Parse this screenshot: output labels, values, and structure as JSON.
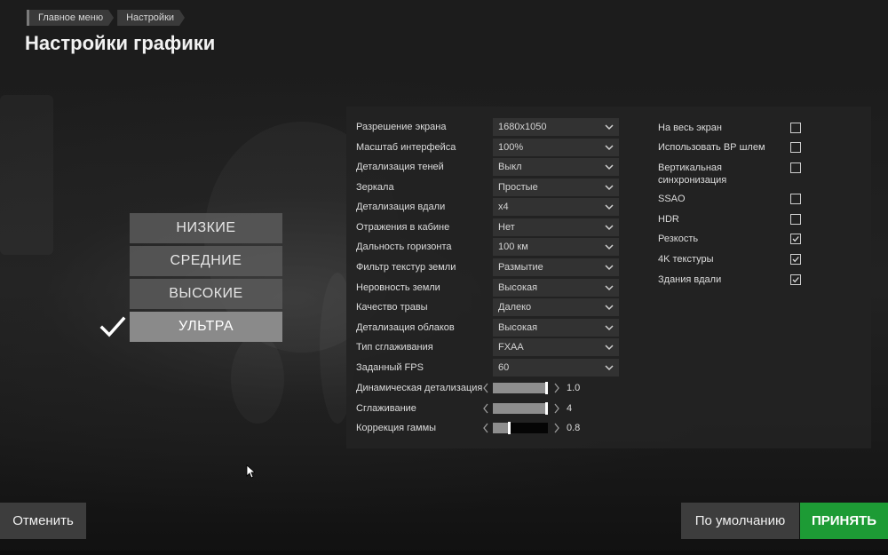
{
  "breadcrumb": [
    "Главное меню",
    "Настройки"
  ],
  "page_title": "Настройки графики",
  "presets": [
    {
      "label": "НИЗКИЕ",
      "active": false
    },
    {
      "label": "СРЕДНИЕ",
      "active": false
    },
    {
      "label": "ВЫСОКИЕ",
      "active": false
    },
    {
      "label": "УЛЬТРА",
      "active": true
    }
  ],
  "dropdowns": [
    {
      "label": "Разрешение экрана",
      "value": "1680x1050"
    },
    {
      "label": "Масштаб интерфейса",
      "value": "100%"
    },
    {
      "label": "Детализация теней",
      "value": "Выкл"
    },
    {
      "label": "Зеркала",
      "value": "Простые"
    },
    {
      "label": "Детализация вдали",
      "value": "x4"
    },
    {
      "label": "Отражения в кабине",
      "value": "Нет"
    },
    {
      "label": "Дальность горизонта",
      "value": "100 км"
    },
    {
      "label": "Фильтр текстур земли",
      "value": "Размытие"
    },
    {
      "label": "Неровность земли",
      "value": "Высокая"
    },
    {
      "label": "Качество травы",
      "value": "Далеко"
    },
    {
      "label": "Детализация облаков",
      "value": "Высокая"
    },
    {
      "label": "Тип сглаживания",
      "value": "FXAA"
    },
    {
      "label": "Заданный FPS",
      "value": "60"
    }
  ],
  "sliders": [
    {
      "label": "Динамическая детализация",
      "value": "1.0",
      "fraction": 1.0
    },
    {
      "label": "Сглаживание",
      "value": "4",
      "fraction": 1.0
    },
    {
      "label": "Коррекция гаммы",
      "value": "0.8",
      "fraction": 0.32
    }
  ],
  "checkboxes": [
    {
      "label": "На весь экран",
      "checked": false
    },
    {
      "label": "Использовать ВР шлем",
      "checked": false
    },
    {
      "label": "Вертикальная синхронизация",
      "checked": false
    },
    {
      "label": "SSAO",
      "checked": false
    },
    {
      "label": "HDR",
      "checked": false
    },
    {
      "label": "Резкость",
      "checked": true
    },
    {
      "label": "4K текстуры",
      "checked": true
    },
    {
      "label": "Здания вдали",
      "checked": true
    }
  ],
  "buttons": {
    "cancel": "Отменить",
    "default": "По умолчанию",
    "accept": "ПРИНЯТЬ"
  },
  "colors": {
    "accept": "#1d9b35",
    "panel": "#222222",
    "preset_active": "#8a8a8a"
  }
}
